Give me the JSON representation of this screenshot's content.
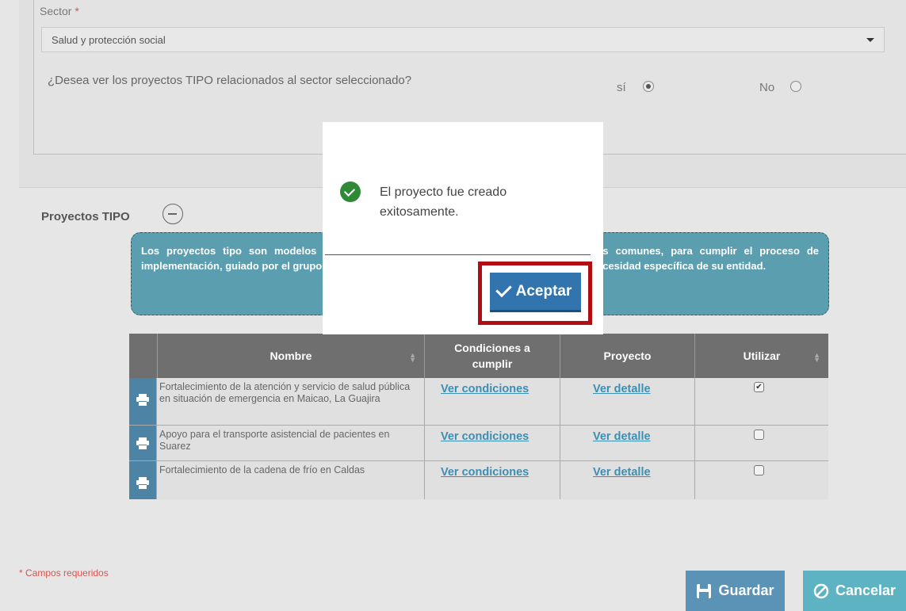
{
  "form": {
    "sector_label": "Sector",
    "required_mark": "*",
    "sector_value": "Salud y protección social",
    "question": "¿Desea ver los proyectos TIPO relacionados al sector seleccionado?",
    "yes_label": "sí",
    "no_label": "No",
    "selected": "sí"
  },
  "section": {
    "title": "Proyectos TIPO",
    "info_text": "Los proyectos tipo son modelos estándar de alternativas de solución a problemáticas comunes, para cumplir el proceso de implementación, guiado por el grupo de estructuración y estructuración, de acuerdo con la necesidad específica de su entidad."
  },
  "table": {
    "headers": [
      "Nombre",
      "Condiciones a cumplir",
      "Proyecto",
      "Utilizar"
    ],
    "rows": [
      {
        "name": "Fortalecimiento de la atención y servicio de salud pública en situación de emergencia en  Maicao, La Guajira",
        "conditions": "Ver condiciones",
        "project": "Ver detalle",
        "use": true
      },
      {
        "name": "Apoyo para el transporte asistencial de pacientes en Suarez",
        "conditions": "Ver condiciones",
        "project": "Ver detalle",
        "use": false
      },
      {
        "name": "Fortalecimiento de la cadena de frío en  Caldas",
        "conditions": "Ver condiciones",
        "project": "Ver detalle",
        "use": false
      }
    ]
  },
  "footer": {
    "required_note": "* Campos requeridos",
    "save_label": "Guardar",
    "cancel_label": "Cancelar"
  },
  "modal": {
    "message": "El proyecto fue creado exitosamente.",
    "accept_label": "Aceptar"
  },
  "colors": {
    "accept": "#3174ae",
    "highlight": "#b10e13",
    "success": "#2f8a35"
  }
}
